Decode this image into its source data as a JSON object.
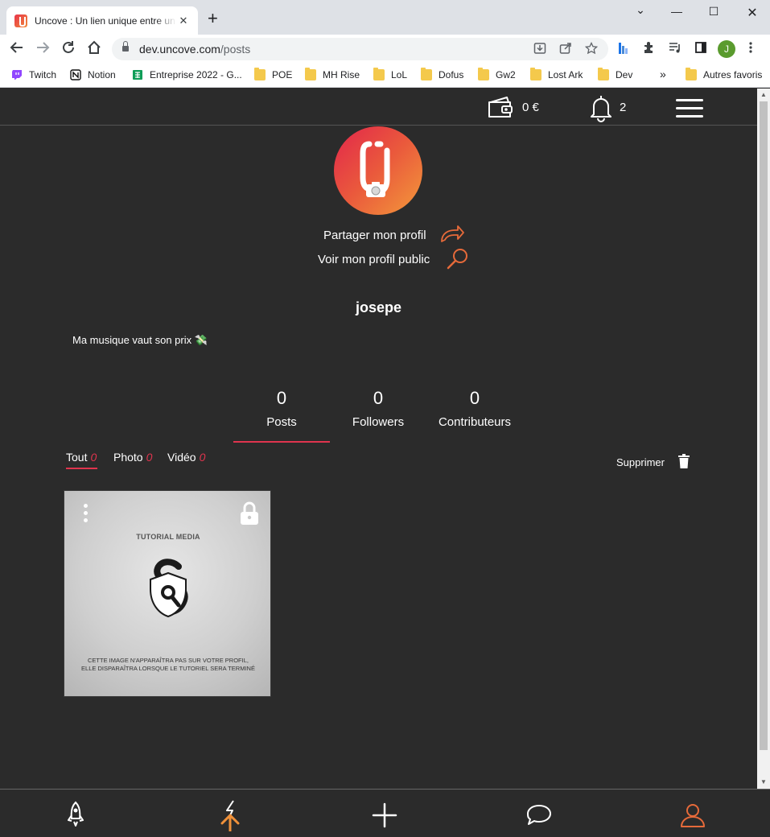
{
  "browser": {
    "tab_title": "Uncove : Un lien unique entre un",
    "tab_close": "✕",
    "new_tab": "+",
    "url_host": "dev.uncove.com",
    "url_path": "/posts",
    "profile_initial": "J",
    "window_controls": {
      "dropdown": "⌄",
      "minimize": "—",
      "maximize": "☐",
      "close": "✕"
    },
    "bookmarks": [
      {
        "label": "Twitch",
        "icon": "twitch-icon",
        "color": "#9146ff"
      },
      {
        "label": "Notion",
        "icon": "notion-icon",
        "color": "#111111"
      },
      {
        "label": "Entreprise 2022 - G...",
        "icon": "sheets-icon",
        "color": "#0f9d58"
      },
      {
        "label": "POE",
        "icon": "folder-icon"
      },
      {
        "label": "MH Rise",
        "icon": "folder-icon"
      },
      {
        "label": "LoL",
        "icon": "folder-icon"
      },
      {
        "label": "Dofus",
        "icon": "folder-icon"
      },
      {
        "label": "Gw2",
        "icon": "folder-icon"
      },
      {
        "label": "Lost Ark",
        "icon": "folder-icon"
      },
      {
        "label": "Dev",
        "icon": "folder-icon"
      }
    ],
    "bookmarks_overflow": "»",
    "other_bookmarks": "Autres favoris"
  },
  "header": {
    "balance": "0 €",
    "notifications": "2"
  },
  "profile": {
    "share_label": "Partager mon profil",
    "public_label": "Voir mon profil public",
    "username": "josepe",
    "bio": "Ma musique vaut son prix 💸"
  },
  "stats": [
    {
      "value": "0",
      "label": "Posts"
    },
    {
      "value": "0",
      "label": "Followers"
    },
    {
      "value": "0",
      "label": "Contributeurs"
    }
  ],
  "filters": [
    {
      "label": "Tout",
      "count": "0"
    },
    {
      "label": "Photo",
      "count": "0"
    },
    {
      "label": "Vidéo",
      "count": "0"
    }
  ],
  "delete_label": "Supprimer",
  "post": {
    "title": "TUTORIAL MEDIA",
    "note_line1": "CETTE IMAGE N'APPARAÎTRA PAS SUR VOTRE PROFIL,",
    "note_line2": "ELLE DISPARAÎTRA LORSQUE LE TUTORIEL SERA TERMINÉ"
  },
  "colors": {
    "accent": "#e0344e",
    "orange": "#f0913a",
    "background": "#2b2b2b"
  }
}
